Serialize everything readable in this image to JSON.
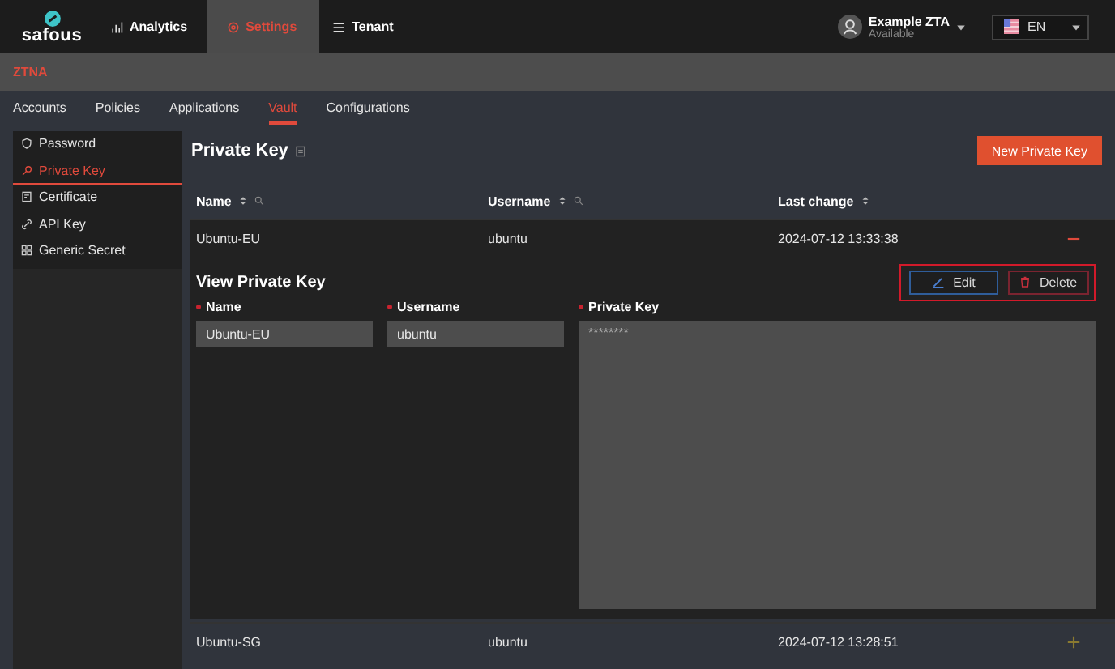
{
  "header": {
    "logo": "safous",
    "nav": [
      {
        "label": "Analytics",
        "selected": false
      },
      {
        "label": "Settings",
        "selected": true
      },
      {
        "label": "Tenant",
        "selected": false
      }
    ],
    "user": {
      "name": "Example ZTA",
      "status": "Available"
    },
    "language": "EN"
  },
  "breadcrumb": "ZTNA",
  "subnav": [
    {
      "label": "Accounts",
      "selected": false
    },
    {
      "label": "Policies",
      "selected": false
    },
    {
      "label": "Applications",
      "selected": false
    },
    {
      "label": "Vault",
      "selected": true
    },
    {
      "label": "Configurations",
      "selected": false
    }
  ],
  "sidebar": {
    "items": [
      {
        "label": "Password",
        "selected": false
      },
      {
        "label": "Private Key",
        "selected": true
      },
      {
        "label": "Certificate",
        "selected": false
      },
      {
        "label": "API Key",
        "selected": false
      },
      {
        "label": "Generic Secret",
        "selected": false
      }
    ]
  },
  "page": {
    "title": "Private Key",
    "new_button": "New Private Key"
  },
  "table": {
    "columns": [
      {
        "label": "Name",
        "sortable": true,
        "searchable": true
      },
      {
        "label": "Username",
        "sortable": true,
        "searchable": true
      },
      {
        "label": "Last change",
        "sortable": true,
        "searchable": false
      }
    ],
    "rows": [
      {
        "name": "Ubuntu-EU",
        "username": "ubuntu",
        "last_change": "2024-07-12 13:33:38",
        "expanded": true,
        "detail": {
          "title": "View Private Key",
          "highlighted": true,
          "actions": [
            {
              "label": "Edit",
              "kind": "edit"
            },
            {
              "label": "Delete",
              "kind": "delete"
            }
          ],
          "fields": [
            {
              "label": "Name",
              "required": true,
              "value": "Ubuntu-EU",
              "kind": "input"
            },
            {
              "label": "Username",
              "required": true,
              "value": "ubuntu",
              "kind": "input"
            },
            {
              "label": "Private Key",
              "required": true,
              "value": "********",
              "kind": "textarea"
            }
          ]
        }
      },
      {
        "name": "Ubuntu-SG",
        "username": "ubuntu",
        "last_change": "2024-07-12 13:28:51",
        "expanded": false
      }
    ]
  }
}
